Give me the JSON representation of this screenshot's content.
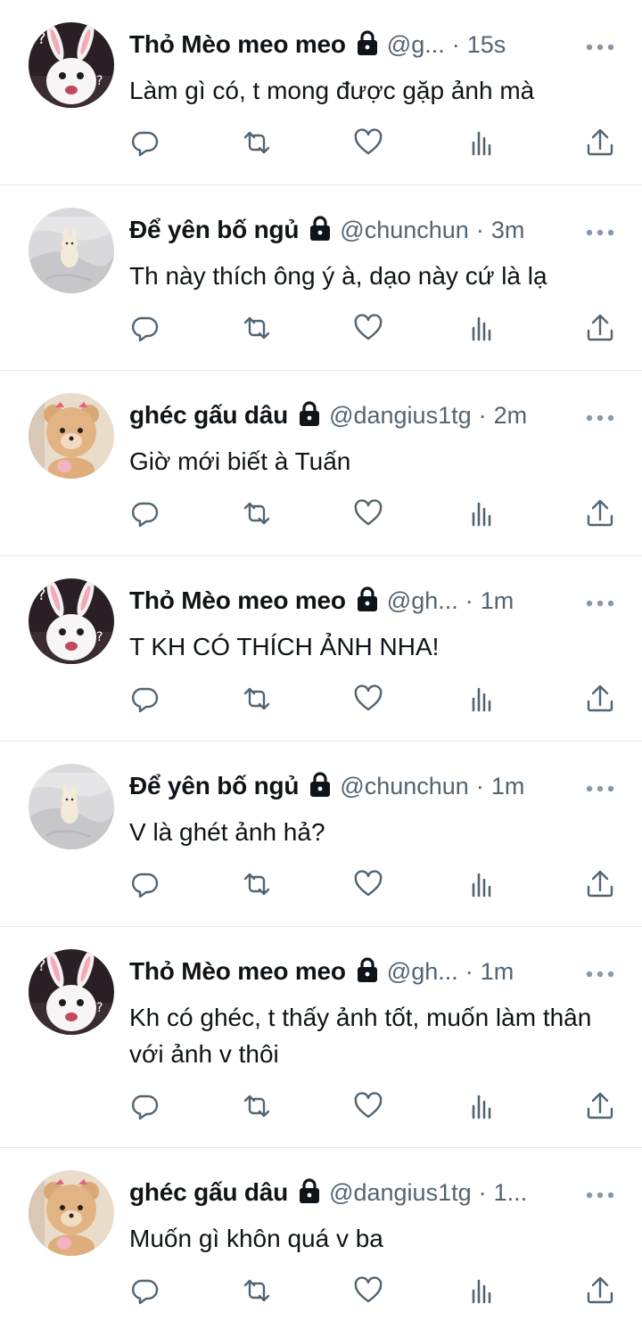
{
  "tweets": [
    {
      "name": "Thỏ Mèo meo meo",
      "handle": "@g...",
      "time": "15s",
      "text": "Làm gì có, t mong được gặp ảnh mà",
      "avatar": "bunny"
    },
    {
      "name": "Để yên bố ngủ",
      "handle": "@chunchun",
      "time": "3m",
      "text": "Th này thích ông ý à, dạo này cứ là lạ",
      "avatar": "blanket"
    },
    {
      "name": "ghéc gấu dâu",
      "handle": "@dangius1tg",
      "time": "2m",
      "text": "Giờ mới biết à Tuấn",
      "avatar": "bear"
    },
    {
      "name": "Thỏ Mèo meo meo",
      "handle": "@gh...",
      "time": "1m",
      "text": "T KH CÓ THÍCH ẢNH NHA!",
      "avatar": "bunny"
    },
    {
      "name": "Để yên bố ngủ",
      "handle": "@chunchun",
      "time": "1m",
      "text": "V là ghét ảnh hả?",
      "avatar": "blanket"
    },
    {
      "name": "Thỏ Mèo meo meo",
      "handle": "@gh...",
      "time": "1m",
      "text": "Kh có ghéc, t thấy ảnh tốt, muốn làm thân với ảnh v thôi",
      "avatar": "bunny"
    },
    {
      "name": "ghéc gấu dâu",
      "handle": "@dangius1tg",
      "time": "1...",
      "text": "Muốn gì khôn quá v ba",
      "avatar": "bear"
    }
  ],
  "icons": {
    "lock": "lock-icon",
    "more": "more-icon",
    "reply": "reply-icon",
    "retweet": "retweet-icon",
    "like": "heart-icon",
    "views": "views-icon",
    "share": "share-icon"
  },
  "colors": {
    "text": "#0f1419",
    "secondary": "#536471",
    "divider": "#e6e9ec"
  }
}
